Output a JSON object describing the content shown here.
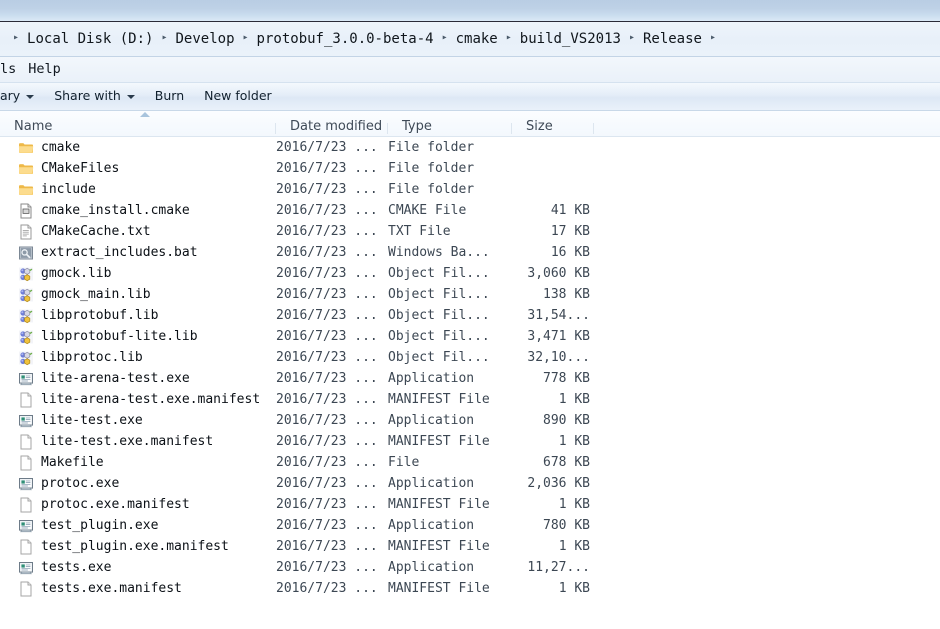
{
  "window": {
    "chrome_color": "#bed1e6"
  },
  "address_bar": {
    "leading_separator": "▸",
    "separator": "▸",
    "crumbs": [
      "Local Disk (D:)",
      "Develop",
      "protobuf_3.0.0-beta-4",
      "cmake",
      "build_VS2013",
      "Release"
    ]
  },
  "menu_bar": {
    "items": [
      "ls",
      "Help"
    ]
  },
  "toolbar": {
    "buttons": [
      {
        "label": "ary",
        "has_caret": true
      },
      {
        "label": "Share with",
        "has_caret": true
      },
      {
        "label": "Burn",
        "has_caret": false
      },
      {
        "label": "New folder",
        "has_caret": false
      }
    ]
  },
  "columns": {
    "name": "Name",
    "date_modified": "Date modified",
    "type": "Type",
    "size": "Size"
  },
  "files": [
    {
      "name": "cmake",
      "date": "2016/7/23 ...",
      "type": "File folder",
      "size": "",
      "icon": "folder-icon"
    },
    {
      "name": "CMakeFiles",
      "date": "2016/7/23 ...",
      "type": "File folder",
      "size": "",
      "icon": "folder-icon"
    },
    {
      "name": "include",
      "date": "2016/7/23 ...",
      "type": "File folder",
      "size": "",
      "icon": "folder-icon"
    },
    {
      "name": "cmake_install.cmake",
      "date": "2016/7/23 ...",
      "type": "CMAKE File",
      "size": "41 KB",
      "icon": "cmake-file-icon"
    },
    {
      "name": "CMakeCache.txt",
      "date": "2016/7/23 ...",
      "type": "TXT File",
      "size": "17 KB",
      "icon": "text-file-icon"
    },
    {
      "name": "extract_includes.bat",
      "date": "2016/7/23 ...",
      "type": "Windows Ba...",
      "size": "16 KB",
      "icon": "batch-file-icon"
    },
    {
      "name": "gmock.lib",
      "date": "2016/7/23 ...",
      "type": "Object Fil...",
      "size": "3,060 KB",
      "icon": "object-file-icon"
    },
    {
      "name": "gmock_main.lib",
      "date": "2016/7/23 ...",
      "type": "Object Fil...",
      "size": "138 KB",
      "icon": "object-file-icon"
    },
    {
      "name": "libprotobuf.lib",
      "date": "2016/7/23 ...",
      "type": "Object Fil...",
      "size": "31,54...",
      "icon": "object-file-icon"
    },
    {
      "name": "libprotobuf-lite.lib",
      "date": "2016/7/23 ...",
      "type": "Object Fil...",
      "size": "3,471 KB",
      "icon": "object-file-icon"
    },
    {
      "name": "libprotoc.lib",
      "date": "2016/7/23 ...",
      "type": "Object Fil...",
      "size": "32,10...",
      "icon": "object-file-icon"
    },
    {
      "name": "lite-arena-test.exe",
      "date": "2016/7/23 ...",
      "type": "Application",
      "size": "778 KB",
      "icon": "application-icon"
    },
    {
      "name": "lite-arena-test.exe.manifest",
      "date": "2016/7/23 ...",
      "type": "MANIFEST File",
      "size": "1 KB",
      "icon": "blank-file-icon"
    },
    {
      "name": "lite-test.exe",
      "date": "2016/7/23 ...",
      "type": "Application",
      "size": "890 KB",
      "icon": "application-icon"
    },
    {
      "name": "lite-test.exe.manifest",
      "date": "2016/7/23 ...",
      "type": "MANIFEST File",
      "size": "1 KB",
      "icon": "blank-file-icon"
    },
    {
      "name": "Makefile",
      "date": "2016/7/23 ...",
      "type": "File",
      "size": "678 KB",
      "icon": "blank-file-icon"
    },
    {
      "name": "protoc.exe",
      "date": "2016/7/23 ...",
      "type": "Application",
      "size": "2,036 KB",
      "icon": "application-icon"
    },
    {
      "name": "protoc.exe.manifest",
      "date": "2016/7/23 ...",
      "type": "MANIFEST File",
      "size": "1 KB",
      "icon": "blank-file-icon"
    },
    {
      "name": "test_plugin.exe",
      "date": "2016/7/23 ...",
      "type": "Application",
      "size": "780 KB",
      "icon": "application-icon"
    },
    {
      "name": "test_plugin.exe.manifest",
      "date": "2016/7/23 ...",
      "type": "MANIFEST File",
      "size": "1 KB",
      "icon": "blank-file-icon"
    },
    {
      "name": "tests.exe",
      "date": "2016/7/23 ...",
      "type": "Application",
      "size": "11,27...",
      "icon": "application-icon"
    },
    {
      "name": "tests.exe.manifest",
      "date": "2016/7/23 ...",
      "type": "MANIFEST File",
      "size": "1 KB",
      "icon": "blank-file-icon"
    }
  ]
}
